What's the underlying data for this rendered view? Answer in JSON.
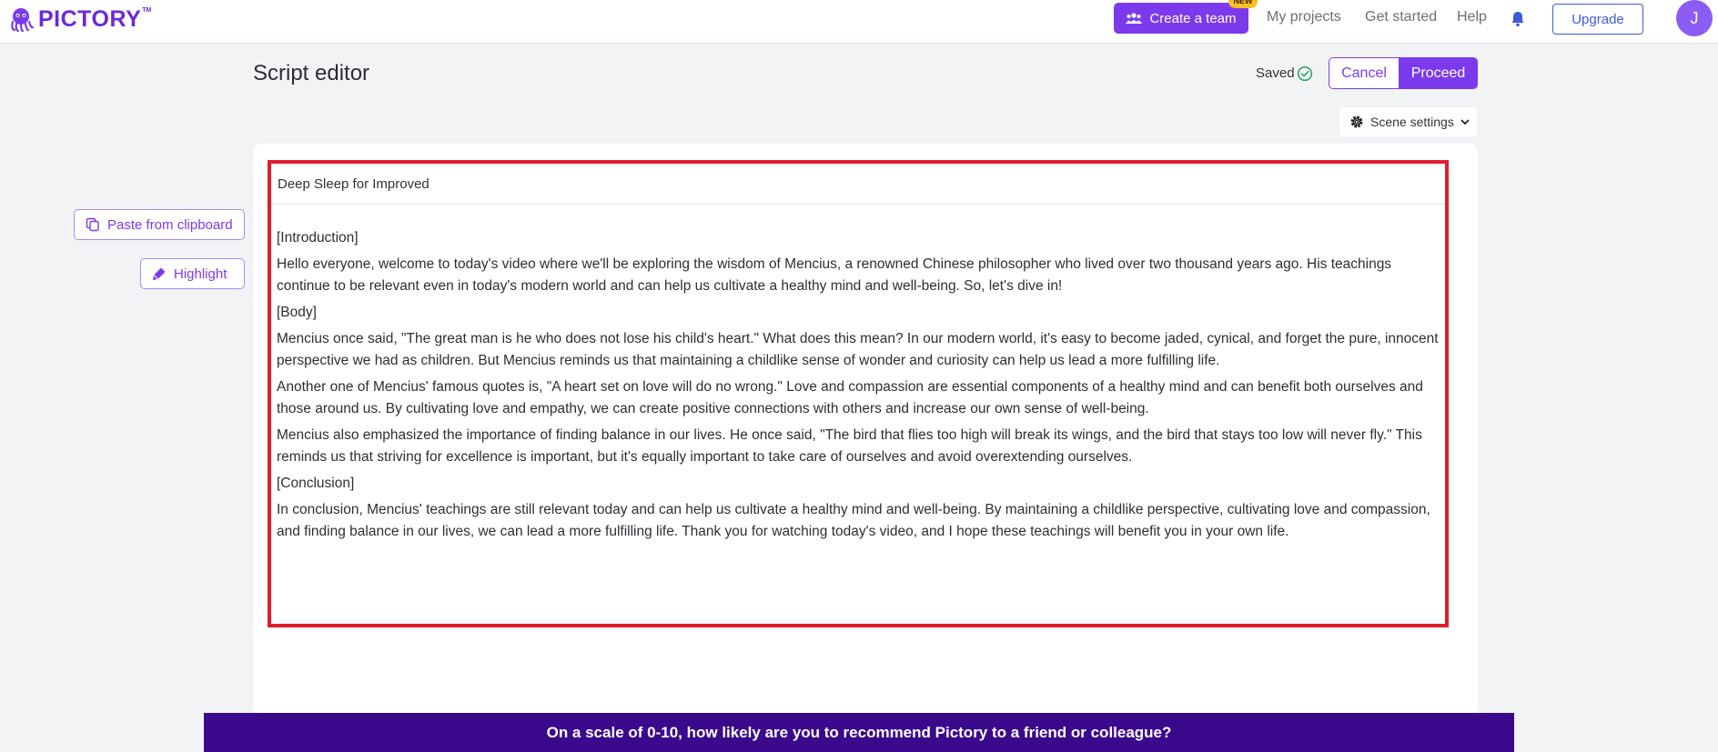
{
  "brand": {
    "name": "PICTORY",
    "tm": "TM",
    "accent": "#7c3aed"
  },
  "nav": {
    "create_team": "Create a team",
    "new_badge": "NEW",
    "my_projects": "My projects",
    "get_started": "Get started",
    "help": "Help",
    "upgrade": "Upgrade",
    "avatar_initial": "J"
  },
  "header": {
    "title": "Script editor",
    "saved": "Saved",
    "cancel": "Cancel",
    "proceed": "Proceed",
    "scene_settings": "Scene settings"
  },
  "tools": {
    "paste": "Paste from clipboard",
    "highlight": "Highlight"
  },
  "editor": {
    "title_value": "Deep Sleep for Improved",
    "paragraphs": [
      "[Introduction]",
      "Hello everyone, welcome to today's video where we'll be exploring the wisdom of Mencius, a renowned Chinese philosopher who lived over two thousand years ago. His teachings continue to be relevant even in today's modern world and can help us cultivate a healthy mind and well-being. So, let's dive in!",
      "[Body]",
      "Mencius once said, \"The great man is he who does not lose his child's heart.\" What does this mean? In our modern world, it's easy to become jaded, cynical, and forget the pure, innocent perspective we had as children. But Mencius reminds us that maintaining a childlike sense of wonder and curiosity can help us lead a more fulfilling life.",
      "Another one of Mencius' famous quotes is, \"A heart set on love will do no wrong.\" Love and compassion are essential components of a healthy mind and can benefit both ourselves and those around us. By cultivating love and empathy, we can create positive connections with others and increase our own sense of well-being.",
      "Mencius also emphasized the importance of finding balance in our lives. He once said, \"The bird that flies too high will break its wings, and the bird that stays too low will never fly.\" This reminds us that striving for excellence is important, but it's equally important to take care of ourselves and avoid overextending ourselves.",
      "[Conclusion]",
      "In conclusion, Mencius' teachings are still relevant today and can help us cultivate a healthy mind and well-being. By maintaining a childlike perspective, cultivating love and compassion, and finding balance in our lives, we can lead a more fulfilling life. Thank you for watching today's video, and I hope these teachings will benefit you in your own life."
    ]
  },
  "survey": {
    "text": "On a scale of 0-10, how likely are you to recommend Pictory to a friend or colleague?"
  },
  "icons": {
    "team": "team-icon",
    "bell": "bell-icon",
    "check": "check-circle-icon",
    "gear": "gear-icon",
    "chevron": "chevron-down-icon",
    "copy": "copy-icon",
    "marker": "marker-icon"
  }
}
